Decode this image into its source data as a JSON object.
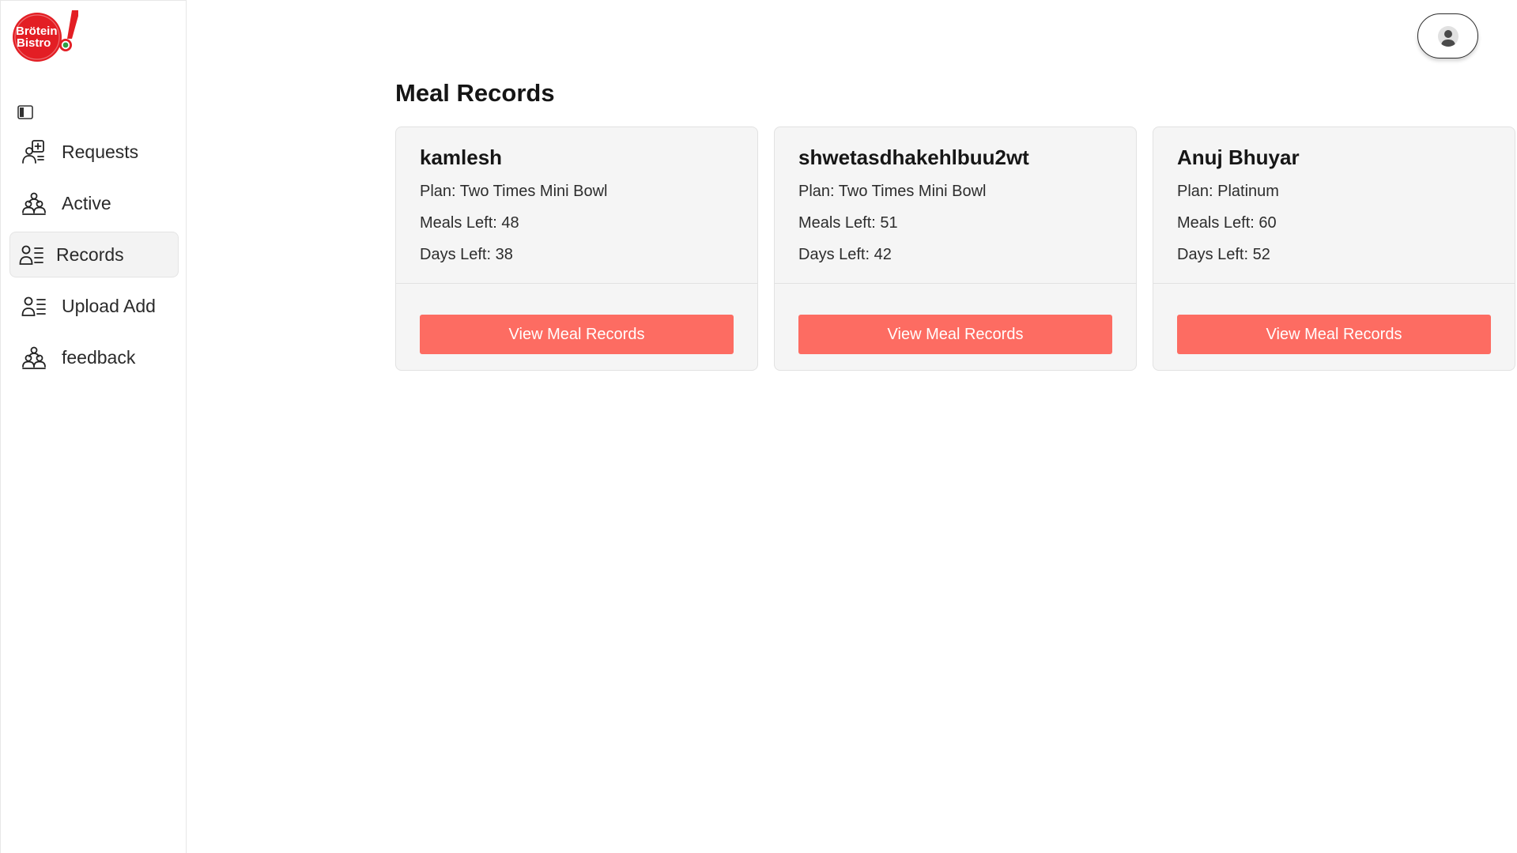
{
  "brand": {
    "line1": "Brötein",
    "line2": "Bistro",
    "accent_color": "#e31e24"
  },
  "sidebar": {
    "toggle_icon": "sidebar-toggle-icon",
    "items": [
      {
        "label": "Requests",
        "icon": "request-add-icon",
        "active": false
      },
      {
        "label": "Active",
        "icon": "users-group-icon",
        "active": false
      },
      {
        "label": "Records",
        "icon": "user-list-icon",
        "active": true
      },
      {
        "label": "Upload Add",
        "icon": "user-list-icon",
        "active": false
      },
      {
        "label": "feedback",
        "icon": "users-group-icon",
        "active": false
      }
    ]
  },
  "header": {
    "avatar_icon": "user-avatar-icon"
  },
  "main": {
    "title": "Meal Records",
    "cards": [
      {
        "name": "kamlesh",
        "plan": "Plan: Two Times Mini Bowl",
        "meals_left": "Meals Left: 48",
        "days_left": "Days Left: 38",
        "button": "View Meal Records"
      },
      {
        "name": "shwetasdhakehlbuu2wt",
        "plan": "Plan: Two Times Mini Bowl",
        "meals_left": "Meals Left: 51",
        "days_left": "Days Left: 42",
        "button": "View Meal Records"
      },
      {
        "name": "Anuj Bhuyar",
        "plan": "Plan: Platinum",
        "meals_left": "Meals Left: 60",
        "days_left": "Days Left: 52",
        "button": "View Meal Records"
      }
    ]
  },
  "colors": {
    "button": "#fd6c62",
    "card_bg": "#f5f5f5",
    "active_nav_bg": "#f3f3f3"
  }
}
